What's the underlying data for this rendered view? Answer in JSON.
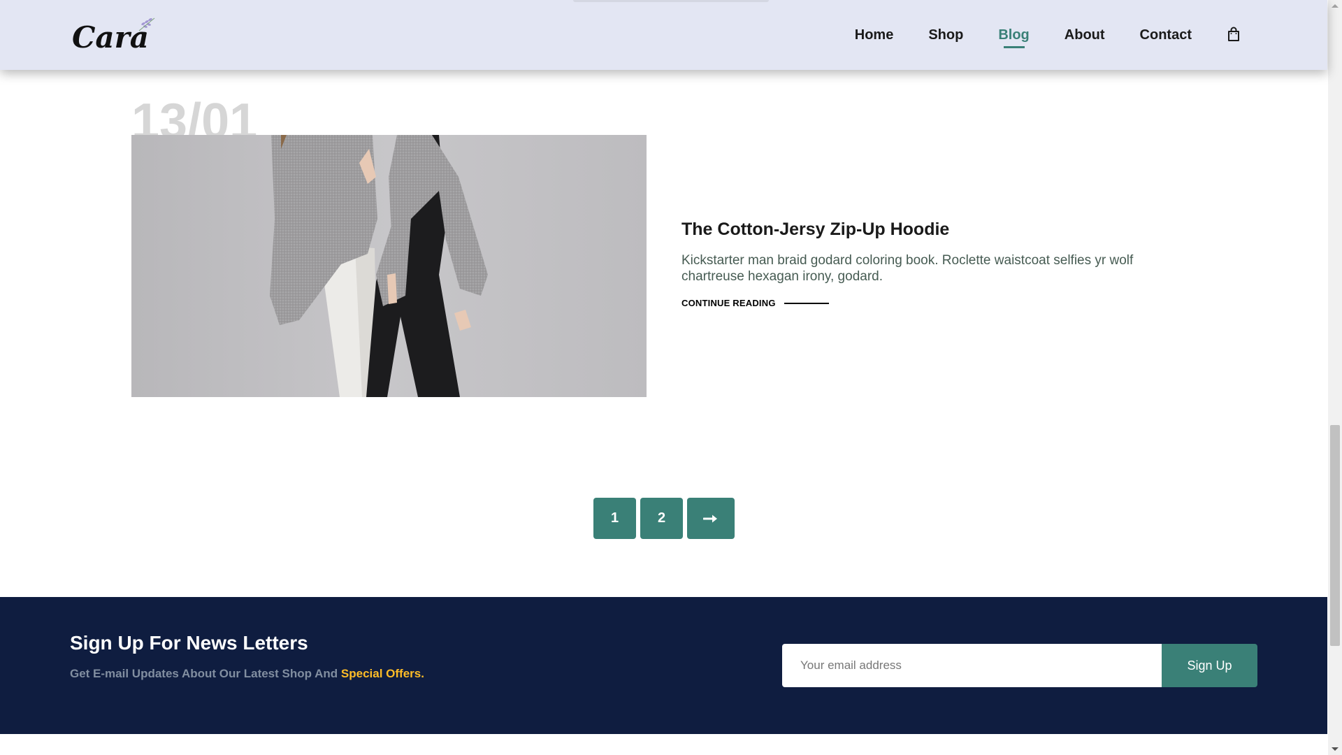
{
  "brand": {
    "logo_text": "Cara"
  },
  "nav": {
    "items": [
      {
        "label": "Home",
        "active": false
      },
      {
        "label": "Shop",
        "active": false
      },
      {
        "label": "Blog",
        "active": true
      },
      {
        "label": "About",
        "active": false
      },
      {
        "label": "Contact",
        "active": false
      }
    ],
    "cart_icon": "shopping-bag-icon"
  },
  "post": {
    "date": "13/01",
    "title": "The Cotton-Jersy Zip-Up Hoodie",
    "excerpt": "Kickstarter man braid godard coloring book. Roclette waistcoat selfies yr wolf chartreuse hexagan irony, godard.",
    "continue_label": "CONTINUE READING"
  },
  "pagination": {
    "pages": [
      "1",
      "2"
    ],
    "next_icon": "arrow-right-icon"
  },
  "newsletter": {
    "title": "Sign Up For News Letters",
    "subtitle": "Get E-mail Updates About Our Latest Shop And",
    "subtitle_highlight": "Special Offers.",
    "email_placeholder": "Your email address",
    "button_label": "Sign Up"
  },
  "colors": {
    "header_bg": "#e3e6f3",
    "accent": "#3a8077",
    "newsletter_bg": "#0f1d40",
    "highlight": "#ffbd27"
  }
}
